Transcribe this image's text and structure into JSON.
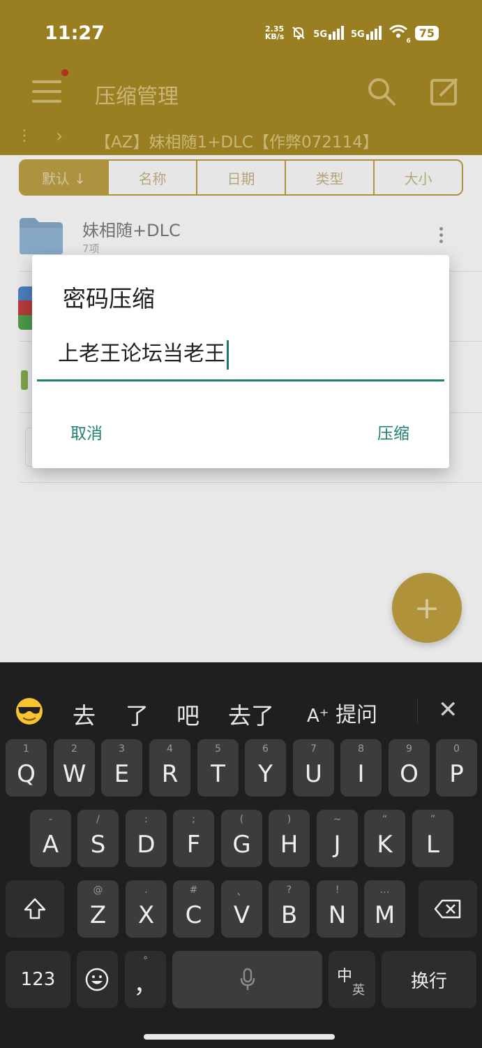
{
  "status": {
    "time": "11:27",
    "net_speed_value": "2.35",
    "net_speed_unit": "KB/s",
    "signal_1": "5G",
    "signal_2": "5G",
    "wifi_badge": "6",
    "battery": "75"
  },
  "app_bar": {
    "title": "压缩管理"
  },
  "path": {
    "folder": "【AZ】妹相随1+DLC【作弊072114】"
  },
  "sort_tabs": [
    "默认 ↓",
    "名称",
    "日期",
    "类型",
    "大小"
  ],
  "file_list": [
    {
      "name": "妹相随+DLC",
      "meta": "7项"
    }
  ],
  "fab": {
    "label": "+"
  },
  "dialog": {
    "title": "密码压缩",
    "input_value": "上老王论坛当老王",
    "cancel_label": "取消",
    "confirm_label": "压缩"
  },
  "keyboard": {
    "candidates": [
      "去",
      "了",
      "吧",
      "去了"
    ],
    "ai_label": "提问",
    "ai_icon": "A⁺",
    "close_icon": "close-icon",
    "row1": [
      {
        "hint": "1",
        "key": "Q"
      },
      {
        "hint": "2",
        "key": "W"
      },
      {
        "hint": "3",
        "key": "E"
      },
      {
        "hint": "4",
        "key": "R"
      },
      {
        "hint": "5",
        "key": "T"
      },
      {
        "hint": "6",
        "key": "Y"
      },
      {
        "hint": "7",
        "key": "U"
      },
      {
        "hint": "8",
        "key": "I"
      },
      {
        "hint": "9",
        "key": "O"
      },
      {
        "hint": "0",
        "key": "P"
      }
    ],
    "row2": [
      {
        "hint": "-",
        "key": "A"
      },
      {
        "hint": "/",
        "key": "S"
      },
      {
        "hint": ":",
        "key": "D"
      },
      {
        "hint": ";",
        "key": "F"
      },
      {
        "hint": "(",
        "key": "G"
      },
      {
        "hint": ")",
        "key": "H"
      },
      {
        "hint": "~",
        "key": "J"
      },
      {
        "hint": "“",
        "key": "K"
      },
      {
        "hint": "”",
        "key": "L"
      }
    ],
    "row3": [
      {
        "hint": "@",
        "key": "Z"
      },
      {
        "hint": ".",
        "key": "X"
      },
      {
        "hint": "#",
        "key": "C"
      },
      {
        "hint": "、",
        "key": "V"
      },
      {
        "hint": "?",
        "key": "B"
      },
      {
        "hint": "!",
        "key": "N"
      },
      {
        "hint": "…",
        "key": "M"
      }
    ],
    "numbers_label": "123",
    "punct_hint": "°",
    "punct_key": "，",
    "lang_main": "中",
    "lang_sub": "英",
    "enter_label": "换行"
  }
}
